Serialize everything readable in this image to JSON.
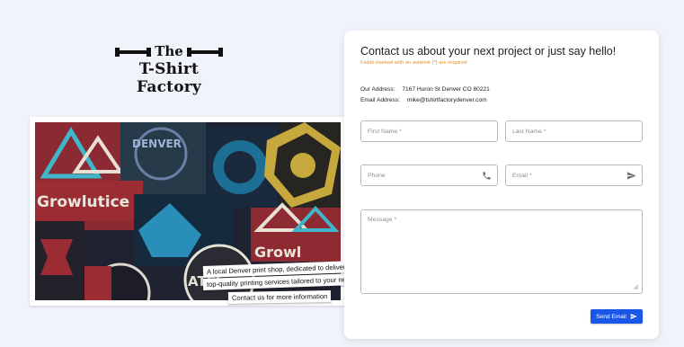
{
  "logo": {
    "line1": "The",
    "line2": "T-Shirt Factory"
  },
  "photo": {
    "alt": "Pile of screen-printed shirts",
    "captions": [
      "A local Denver print shop, dedicated to delivering",
      "top-quality printing services tailored to your needs",
      "Contact us for more information"
    ],
    "shirt_words": [
      "Growlutice",
      "DENVER",
      "Growl",
      "ATEL"
    ]
  },
  "contact": {
    "title": "Contact us about your next project or just say hello!",
    "required_note": "Fields marked with an asterisk (*) are required",
    "address_label": "Our Address:",
    "address_value": "7167 Huron St Denver CO 80221",
    "email_label": "Email Address:",
    "email_value": "mike@tshirtfactorydenver.com",
    "fields": {
      "first_name": {
        "placeholder": "First Name *",
        "value": ""
      },
      "last_name": {
        "placeholder": "Last Name *",
        "value": ""
      },
      "phone": {
        "placeholder": "Phone",
        "value": "",
        "icon": "phone-icon"
      },
      "email": {
        "placeholder": "Email *",
        "value": "",
        "icon": "send-icon"
      },
      "message": {
        "placeholder": "Message *",
        "value": ""
      }
    },
    "send_label": "Send Email",
    "accent_color": "#1a57e8",
    "note_color": "#e0902c"
  }
}
